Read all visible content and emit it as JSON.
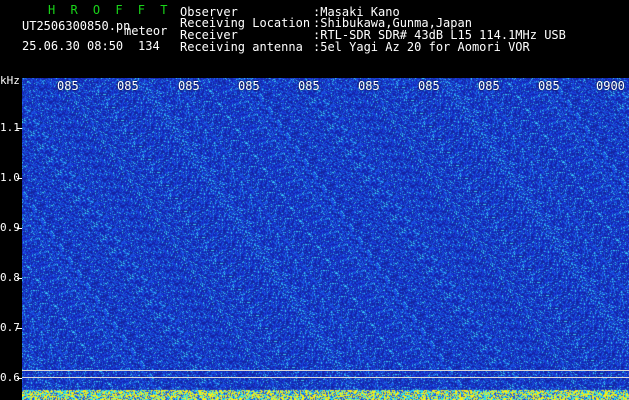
{
  "header": {
    "title": "H R O F F T",
    "filename": "UT2506300850.pn",
    "mode": "meteor",
    "datetime": "25.06.30 08:50",
    "count": "134",
    "fields": [
      {
        "label": "Observer",
        "value": ":Masaki Kano"
      },
      {
        "label": "Receiving Location",
        "value": ":Shibukawa,Gunma,Japan"
      },
      {
        "label": "Receiver",
        "value": ":RTL-SDR SDR# 43dB L15 114.1MHz USB"
      },
      {
        "label": "Receiving antenna",
        "value": ":5el Yagi Az 20 for Aomori VOR"
      }
    ]
  },
  "spectrogram": {
    "y_unit": "kHz",
    "y_ticks": [
      "1.1",
      "1.0",
      "0.9",
      "0.8",
      "0.7",
      "0.6"
    ],
    "x_ticks": [
      "085",
      "085",
      "085",
      "085",
      "085",
      "085",
      "085",
      "085",
      "085",
      "0900"
    ],
    "colors": {
      "background": "#000000",
      "base_blue": "#1a3ad0",
      "noise_cyan": "#2fd0f0",
      "title_green": "#19d419"
    }
  }
}
